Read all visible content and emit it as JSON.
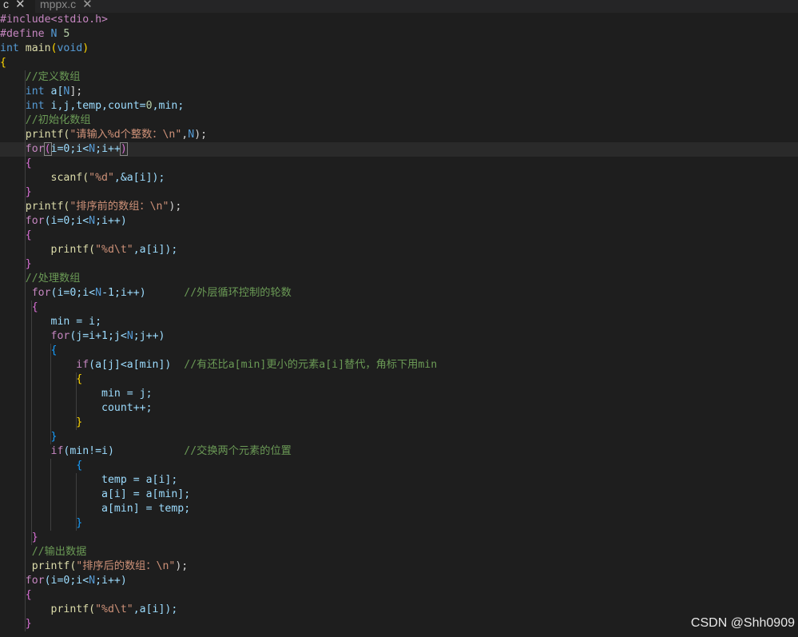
{
  "tabs": [
    {
      "name": "c",
      "close": "✕"
    },
    {
      "name": "mppx.c",
      "close": "✕"
    }
  ],
  "code": {
    "l1": "#include<stdio.h>",
    "l2a": "#define",
    "l2b": " N ",
    "l2c": "5",
    "l3a": "int",
    "l3b": " main",
    "l3c": "(",
    "l3d": "void",
    "l3e": ")",
    "l4": "{",
    "l5": "    //定义数组",
    "l6a": "    int",
    "l6b": " a[",
    "l6c": "N",
    "l6d": "];",
    "l7a": "    int",
    "l7b": " i,j,temp,count=",
    "l7c": "0",
    "l7d": ",min;",
    "l8": "    //初始化数组",
    "l9a": "    printf(",
    "l9b": "\"请输入%d个整数：\\n\"",
    "l9c": ",",
    "l9d": "N",
    "l9e": ");",
    "l10a": "    for",
    "l10b": "(",
    "l10c": "i=0;i<",
    "l10d": "N",
    "l10e": ";i++",
    "l10f": ")",
    "l11": "    {",
    "l12a": "        scanf(",
    "l12b": "\"%d\"",
    "l12c": ",&a[i]);",
    "l13": "    }",
    "l14a": "    printf(",
    "l14b": "\"排序前的数组：\\n\"",
    "l14c": ");",
    "l15a": "    for",
    "l15b": "(i=0;i<",
    "l15c": "N",
    "l15d": ";i++)",
    "l16": "    {",
    "l17a": "        printf(",
    "l17b": "\"%d\\t\"",
    "l17c": ",a[i]);",
    "l18": "    }",
    "l19": "    //处理数组",
    "l20a": "     for",
    "l20b": "(i=0;i<",
    "l20c": "N",
    "l20d": "-1;i++)      ",
    "l20e": "//外层循环控制的轮数",
    "l21": "     {",
    "l22a": "        min = i;",
    "l23a": "        for",
    "l23b": "(j=i+1;j<",
    "l23c": "N",
    "l23d": ";j++)",
    "l24": "        {",
    "l25a": "            if",
    "l25b": "(a[j]<a[min])  ",
    "l25c": "//有还比a[min]更小的元素a[i]替代，角标下用min",
    "l26": "            {",
    "l27": "                min = j;",
    "l28": "                count++;",
    "l29": "            }",
    "l30": "        }",
    "l31a": "        if",
    "l31b": "(min!=i)           ",
    "l31c": "//交换两个元素的位置",
    "l32": "            {",
    "l33": "                temp = a[i];",
    "l34": "                a[i] = a[min];",
    "l35": "                a[min] = temp;",
    "l36": "            }",
    "l37": "     }",
    "l38": "     //输出数据",
    "l39a": "     printf(",
    "l39b": "\"排序后的数组：\\n\"",
    "l39c": ");",
    "l40a": "    for",
    "l40b": "(i=0;i<",
    "l40c": "N",
    "l40d": ";i++)",
    "l41": "    {",
    "l42a": "        printf(",
    "l42b": "\"%d\\t\"",
    "l42c": ",a[i]);",
    "l43": "    }"
  },
  "watermark": "CSDN @Shh0909"
}
